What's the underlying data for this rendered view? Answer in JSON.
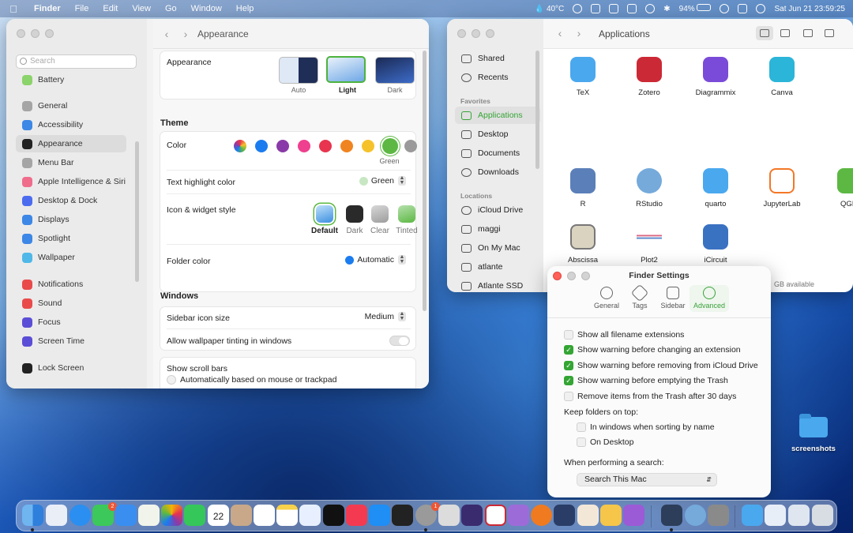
{
  "menubar": {
    "app_name": "Finder",
    "menus": [
      "File",
      "Edit",
      "View",
      "Go",
      "Window",
      "Help"
    ],
    "temperature": "40°C",
    "battery": "94%",
    "clock": "Sat Jun 21  23:59:25"
  },
  "settings": {
    "search_placeholder": "Search",
    "sidebar": [
      {
        "label": "Battery",
        "color": "#8bd36b"
      },
      {
        "label": "General",
        "color": "#a5a5a5"
      },
      {
        "label": "Accessibility",
        "color": "#3d87e6"
      },
      {
        "label": "Appearance",
        "color": "#222222"
      },
      {
        "label": "Menu Bar",
        "color": "#a5a5a5"
      },
      {
        "label": "Apple Intelligence & Siri",
        "color": "#f06c8b"
      },
      {
        "label": "Desktop & Dock",
        "color": "#4c6cf0"
      },
      {
        "label": "Displays",
        "color": "#3d87e6"
      },
      {
        "label": "Spotlight",
        "color": "#3d87e6"
      },
      {
        "label": "Wallpaper",
        "color": "#4fb8e8"
      },
      {
        "label": "Notifications",
        "color": "#e94b4b"
      },
      {
        "label": "Sound",
        "color": "#e94b4b"
      },
      {
        "label": "Focus",
        "color": "#5b4ed6"
      },
      {
        "label": "Screen Time",
        "color": "#5b4ed6"
      },
      {
        "label": "Lock Screen",
        "color": "#222222"
      }
    ],
    "title": "Appearance",
    "appearance_label": "Appearance",
    "appearance_options": [
      "Auto",
      "Light",
      "Dark"
    ],
    "theme_heading": "Theme",
    "color_label": "Color",
    "accent_colors": [
      "multicolor",
      "#1b7cf0",
      "#8a3aa8",
      "#ef3f8f",
      "#e8344e",
      "#f08420",
      "#f6c22b",
      "#5cb843",
      "#9a9a9a"
    ],
    "selected_color_name": "Green",
    "text_highlight_label": "Text highlight color",
    "text_highlight_value": "Green",
    "icon_style_label": "Icon & widget style",
    "icon_styles": [
      "Default",
      "Dark",
      "Clear",
      "Tinted"
    ],
    "folder_color_label": "Folder color",
    "folder_color_value": "Automatic",
    "windows_heading": "Windows",
    "sidebar_icon_size_label": "Sidebar icon size",
    "sidebar_icon_size_value": "Medium",
    "wallpaper_tinting_label": "Allow wallpaper tinting in windows",
    "scroll_bars_label": "Show scroll bars",
    "scroll_option": "Automatically based on mouse or trackpad"
  },
  "finder": {
    "title": "Applications",
    "sidebar": {
      "top": [
        "Shared",
        "Recents"
      ],
      "favorites_heading": "Favorites",
      "favorites": [
        "Applications",
        "Desktop",
        "Documents",
        "Downloads"
      ],
      "locations_heading": "Locations",
      "locations": [
        "iCloud Drive",
        "maggi",
        "On My Mac",
        "atlante",
        "Atlante SSD"
      ]
    },
    "apps": [
      {
        "name": "TeX",
        "color": "#4aa8ee"
      },
      {
        "name": "Zotero",
        "color": "#cc2936"
      },
      {
        "name": "Diagrammix",
        "color": "#7a4bd8"
      },
      {
        "name": "Canva",
        "color": "#2bb5d8"
      },
      {
        "name": "R",
        "color": "#5b7fb8"
      },
      {
        "name": "RStudio",
        "color": "#75aadb"
      },
      {
        "name": "quarto",
        "color": "#4aa8ee"
      },
      {
        "name": "JupyterLab",
        "color": "#f37726"
      },
      {
        "name": "QGIS",
        "color": "#5cb843"
      },
      {
        "name": "Abscissa",
        "color": "#888888"
      },
      {
        "name": "Plot2",
        "color": "#d44a6b"
      },
      {
        "name": "iCircuit",
        "color": "#3a72c2"
      }
    ],
    "status": "GB available"
  },
  "finder_settings": {
    "title": "Finder Settings",
    "tabs": [
      "General",
      "Tags",
      "Sidebar",
      "Advanced"
    ],
    "options": [
      {
        "label": "Show all filename extensions",
        "checked": false
      },
      {
        "label": "Show warning before changing an extension",
        "checked": true
      },
      {
        "label": "Show warning before removing from iCloud Drive",
        "checked": true
      },
      {
        "label": "Show warning before emptying the Trash",
        "checked": true
      },
      {
        "label": "Remove items from the Trash after 30 days",
        "checked": false
      }
    ],
    "keep_folders_heading": "Keep folders on top:",
    "keep_folders_options": [
      {
        "label": "In windows when sorting by name",
        "checked": false
      },
      {
        "label": "On Desktop",
        "checked": false
      }
    ],
    "search_heading": "When performing a search:",
    "search_value": "Search This Mac"
  },
  "desktop": {
    "folder_label": "screenshots"
  },
  "dock": {
    "calendar_day": "22",
    "messages_badge": "2",
    "settings_badge": "1"
  }
}
